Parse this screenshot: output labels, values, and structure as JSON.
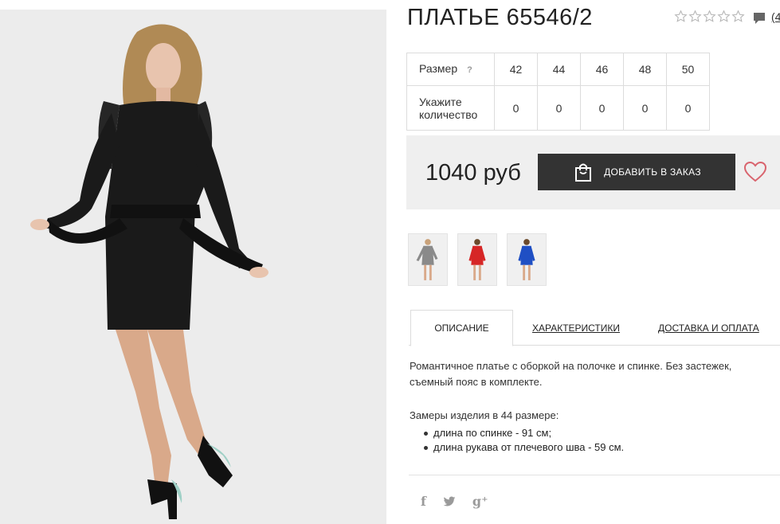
{
  "product": {
    "title": "ПЛАТЬЕ 65546/2",
    "rating_stars": 5,
    "rating_filled": 0,
    "comment_count": "(4",
    "price": "1040 руб",
    "add_button": "ДОБАВИТЬ В ЗАКАЗ"
  },
  "size_table": {
    "size_label": "Размер",
    "help": "?",
    "qty_label_1": "Укажите",
    "qty_label_2": "количество",
    "sizes": [
      "42",
      "44",
      "46",
      "48",
      "50"
    ],
    "quantities": [
      "0",
      "0",
      "0",
      "0",
      "0"
    ]
  },
  "thumbnails": [
    {
      "name": "grey-dress"
    },
    {
      "name": "red-dress"
    },
    {
      "name": "blue-dress"
    }
  ],
  "tabs": {
    "description": "ОПИСАНИЕ",
    "specs": "ХАРАКТЕРИСТИКИ",
    "delivery": "ДОСТАВКА И ОПЛАТА"
  },
  "description": {
    "text": "Романтичное платье с оборкой на полочке и спинке. Без застежек, съемный пояс в комплекте.",
    "measure_title": "Замеры изделия в 44 размере:",
    "measures": [
      "длина по спинке - 91 см;",
      "длина рукава от плечевого шва - 59 см."
    ]
  },
  "social": {
    "facebook": "f",
    "twitter": "🐦",
    "google": "g⁺"
  },
  "colors": {
    "button_bg": "#333333",
    "price_bg": "#efefef",
    "heart": "#d9646e",
    "dress_black": "#1a1a1a",
    "dress_red": "#d62626",
    "dress_blue": "#1f4fc4",
    "dress_grey": "#8a8a8a"
  },
  "icons": [
    "star-icon",
    "comment-icon",
    "shopping-bag-icon",
    "heart-icon",
    "facebook-icon",
    "twitter-icon",
    "google-plus-icon"
  ]
}
